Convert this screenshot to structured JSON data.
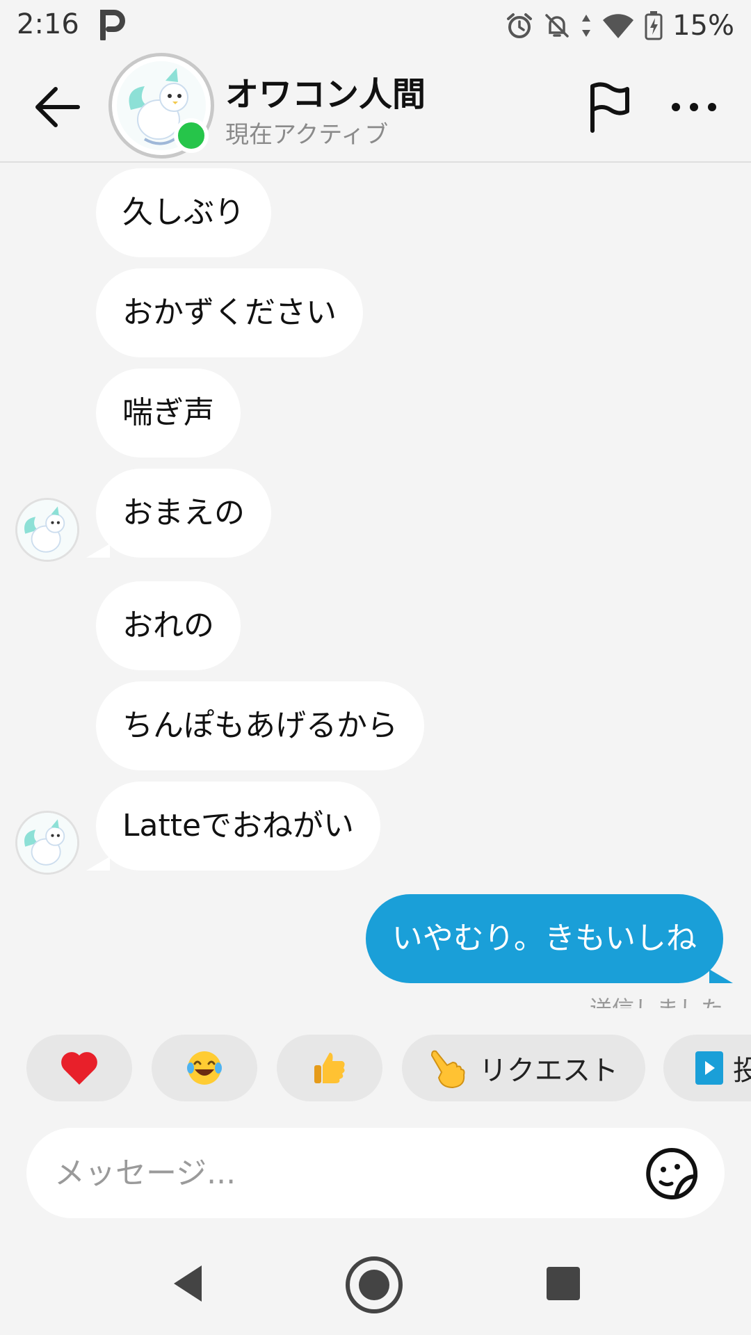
{
  "status_bar": {
    "time": "2:16",
    "battery_percent": "15%",
    "icons": [
      "parking-app-icon",
      "alarm-icon",
      "notifications-off-icon",
      "data-arrows-icon",
      "wifi-icon",
      "battery-charging-icon"
    ]
  },
  "header": {
    "contact_name": "オワコン人間",
    "contact_status": "現在アクティブ",
    "online": true,
    "online_color": "#26c54a",
    "icons": [
      "back-arrow-icon",
      "flag-icon",
      "more-icon"
    ]
  },
  "messages": [
    {
      "from": "them",
      "text": "久しぶり"
    },
    {
      "from": "them",
      "text": "おかずください"
    },
    {
      "from": "them",
      "text": "喘ぎ声"
    },
    {
      "from": "them",
      "text": "おまえの"
    },
    {
      "from": "them",
      "text": "おれの"
    },
    {
      "from": "them",
      "text": "ちんぽもあげるから"
    },
    {
      "from": "them",
      "text": "Latteでおねがい"
    },
    {
      "from": "me",
      "text": "いやむり。きもいしね"
    }
  ],
  "sent_status": "送信しました",
  "quick_reactions": [
    {
      "icon": "heart-emoji-icon",
      "label": ""
    },
    {
      "icon": "laughing-tears-emoji-icon",
      "label": ""
    },
    {
      "icon": "thumbs-up-emoji-icon",
      "label": ""
    },
    {
      "icon": "pointing-hand-emoji-icon",
      "label": "リクエスト"
    },
    {
      "icon": "video-play-icon",
      "label": "投"
    }
  ],
  "composer": {
    "placeholder": "メッセージ...",
    "value": ""
  },
  "colors": {
    "outgoing_bubble": "#1a9fd8",
    "incoming_bubble": "#ffffff",
    "background": "#f4f4f4"
  },
  "nav_bar": {
    "icons": [
      "nav-back-icon",
      "nav-home-icon",
      "nav-recents-icon"
    ]
  }
}
